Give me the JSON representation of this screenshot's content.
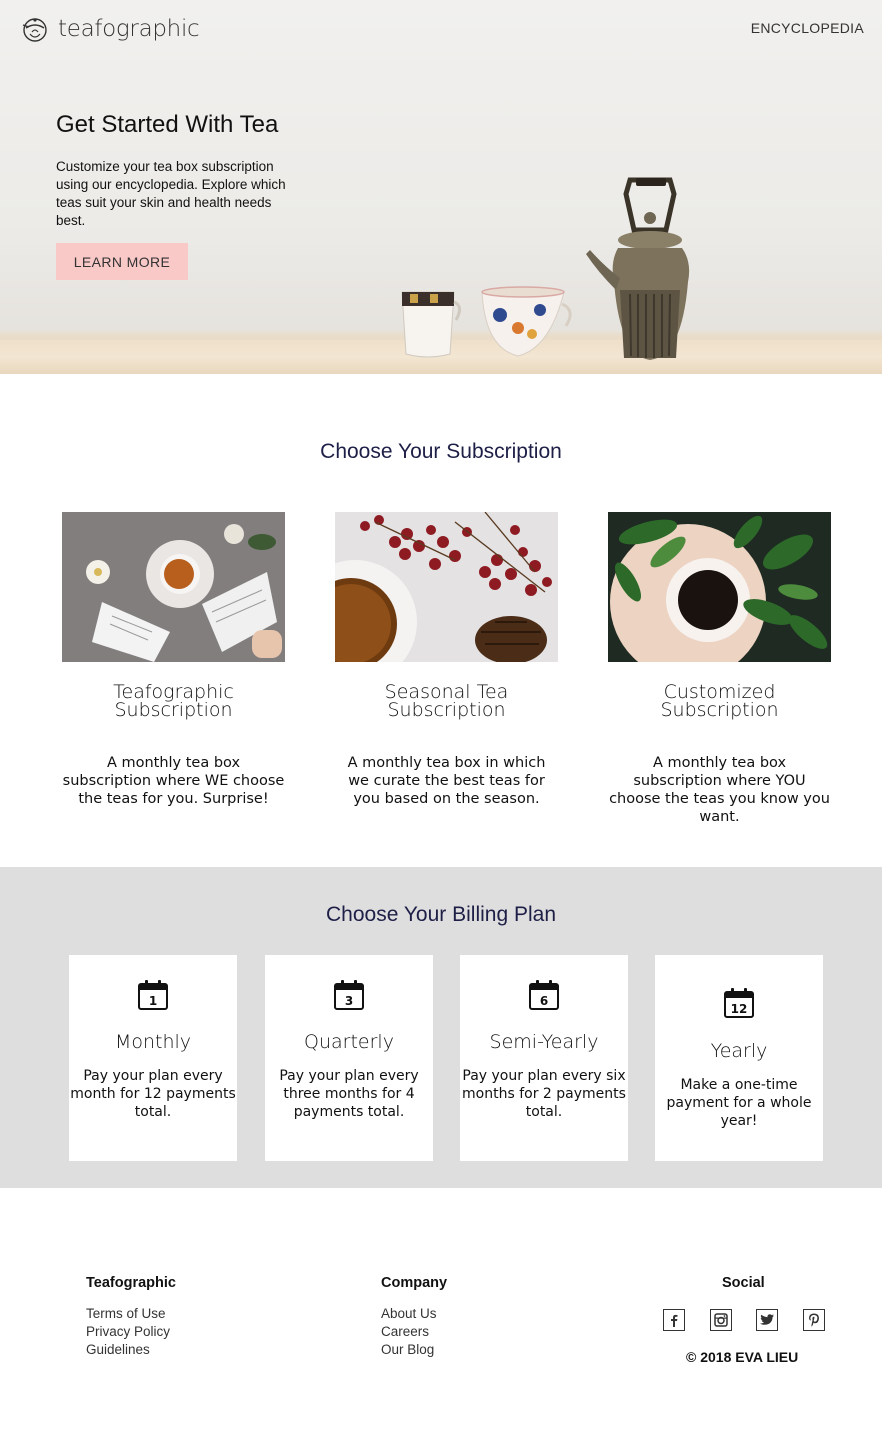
{
  "header": {
    "brand": "teafographic",
    "nav": "ENCYCLOPEDIA"
  },
  "hero": {
    "title": "Get Started With Tea",
    "lede": "Customize your tea box subscription using our encyclopedia. Explore which teas suit your skin and health needs best.",
    "cta": "LEARN MORE"
  },
  "subscriptions": {
    "heading": "Choose Your Subscription",
    "cards": [
      {
        "title": "Teafographic Subscription",
        "desc": "A monthly tea box subscription where WE choose the teas for you. Surprise!"
      },
      {
        "title": "Seasonal Tea Subscription",
        "desc": "A monthly tea box in which we curate the best teas for you based on the season."
      },
      {
        "title": "Customized Subscription",
        "desc": "A monthly tea box subscription where YOU choose the teas you know you want."
      }
    ]
  },
  "billing": {
    "heading": "Choose Your Billing Plan",
    "plans": [
      {
        "icon_number": "1",
        "name": "Monthly",
        "desc": "Pay your plan every month for 12 payments total."
      },
      {
        "icon_number": "3",
        "name": "Quarterly",
        "desc": "Pay your plan every three months for 4 payments total."
      },
      {
        "icon_number": "6",
        "name": "Semi-Yearly",
        "desc": "Pay your plan every six months for 2 payments total."
      },
      {
        "icon_number": "12",
        "name": "Yearly",
        "desc": "Make a one-time payment for a whole year!"
      }
    ]
  },
  "footer": {
    "col1": {
      "heading": "Teafographic",
      "links": [
        "Terms of Use",
        "Privacy Policy",
        "Guidelines"
      ]
    },
    "col2": {
      "heading": "Company",
      "links": [
        "About Us",
        "Careers",
        "Our Blog"
      ]
    },
    "social": {
      "heading": "Social",
      "icons": [
        "facebook-icon",
        "instagram-icon",
        "twitter-icon",
        "pinterest-icon"
      ]
    },
    "copyright": "© 2018 EVA LIEU"
  },
  "colors": {
    "accent_pink": "#f9c9c8",
    "heading_navy": "#1e1f47",
    "billing_bg": "#dedede"
  }
}
